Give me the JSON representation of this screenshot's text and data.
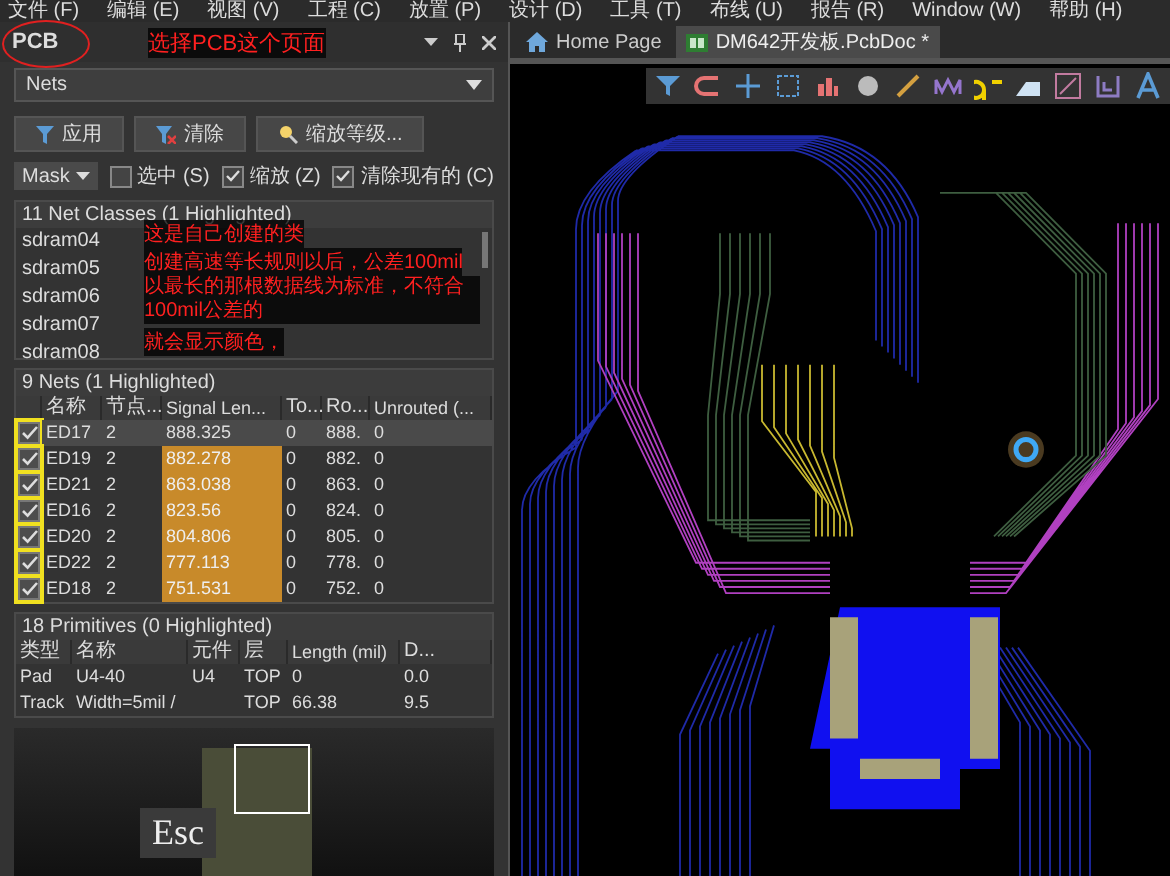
{
  "menu_bar": [
    "文件 (F)",
    "编辑 (E)",
    "视图 (V)",
    "工程 (C)",
    "放置 (P)",
    "设计 (D)",
    "工具 (T)",
    "布线 (U)",
    "报告 (R)",
    "Window (W)",
    "帮助 (H)"
  ],
  "panel": {
    "title": "PCB",
    "mode": "Nets",
    "buttons": [
      {
        "label": "应用",
        "kind": "filter"
      },
      {
        "label": "清除",
        "kind": "clear"
      },
      {
        "label": "缩放等级...",
        "kind": "zoom"
      }
    ],
    "mask": "Mask",
    "options": [
      {
        "label": "选中 (S)",
        "checked": false
      },
      {
        "label": "缩放 (Z)",
        "checked": true
      },
      {
        "label": "清除现有的 (C)",
        "checked": true
      }
    ],
    "net_classes": {
      "header": "11 Net Classes (1 Highlighted)",
      "items": [
        "sdram04",
        "sdram05",
        "sdram06",
        "sdram07",
        "sdram08"
      ]
    },
    "nets": {
      "header": "9 Nets (1 Highlighted)",
      "columns": [
        "名称",
        "节点...",
        "Signal Len...",
        "To...",
        "Ro...",
        "Unrouted (..."
      ],
      "rows": [
        {
          "checked": true,
          "selected": true,
          "highlighted": false,
          "cells": [
            "ED17",
            "2",
            "888.325",
            "0",
            "888.",
            "0"
          ]
        },
        {
          "checked": true,
          "selected": false,
          "highlighted": true,
          "cells": [
            "ED19",
            "2",
            "882.278",
            "0",
            "882.",
            "0"
          ]
        },
        {
          "checked": true,
          "selected": false,
          "highlighted": true,
          "cells": [
            "ED21",
            "2",
            "863.038",
            "0",
            "863.",
            "0"
          ]
        },
        {
          "checked": true,
          "selected": false,
          "highlighted": true,
          "cells": [
            "ED16",
            "2",
            "823.56",
            "0",
            "824.",
            "0"
          ]
        },
        {
          "checked": true,
          "selected": false,
          "highlighted": true,
          "cells": [
            "ED20",
            "2",
            "804.806",
            "0",
            "805.",
            "0"
          ]
        },
        {
          "checked": true,
          "selected": false,
          "highlighted": true,
          "cells": [
            "ED22",
            "2",
            "777.113",
            "0",
            "778.",
            "0"
          ]
        },
        {
          "checked": true,
          "selected": false,
          "highlighted": true,
          "cells": [
            "ED18",
            "2",
            "751.531",
            "0",
            "752.",
            "0"
          ]
        }
      ]
    },
    "primitives": {
      "header": "18 Primitives (0 Highlighted)",
      "columns": [
        "类型",
        "名称",
        "元件",
        "层",
        "Length (mil)",
        "D..."
      ],
      "rows": [
        [
          "Pad",
          "U4-40",
          "U4",
          "TOP",
          "0",
          "0.0"
        ],
        [
          "Track",
          "Width=5mil /",
          "",
          "TOP",
          "66.38",
          "9.5"
        ]
      ]
    },
    "key_overlay": "Esc"
  },
  "tabs": [
    {
      "label": "Home Page",
      "kind": "home",
      "selected": false
    },
    {
      "label": "DM642开发板.PcbDoc *",
      "kind": "pcb",
      "selected": true
    }
  ],
  "annotations": [
    "选择PCB这个页面",
    "这是自己创建的类",
    "创建高速等长规则以后，公差100mil",
    "以最长的那根数据线为标准，不符合100mil公差的",
    "就会显示颜色，"
  ]
}
